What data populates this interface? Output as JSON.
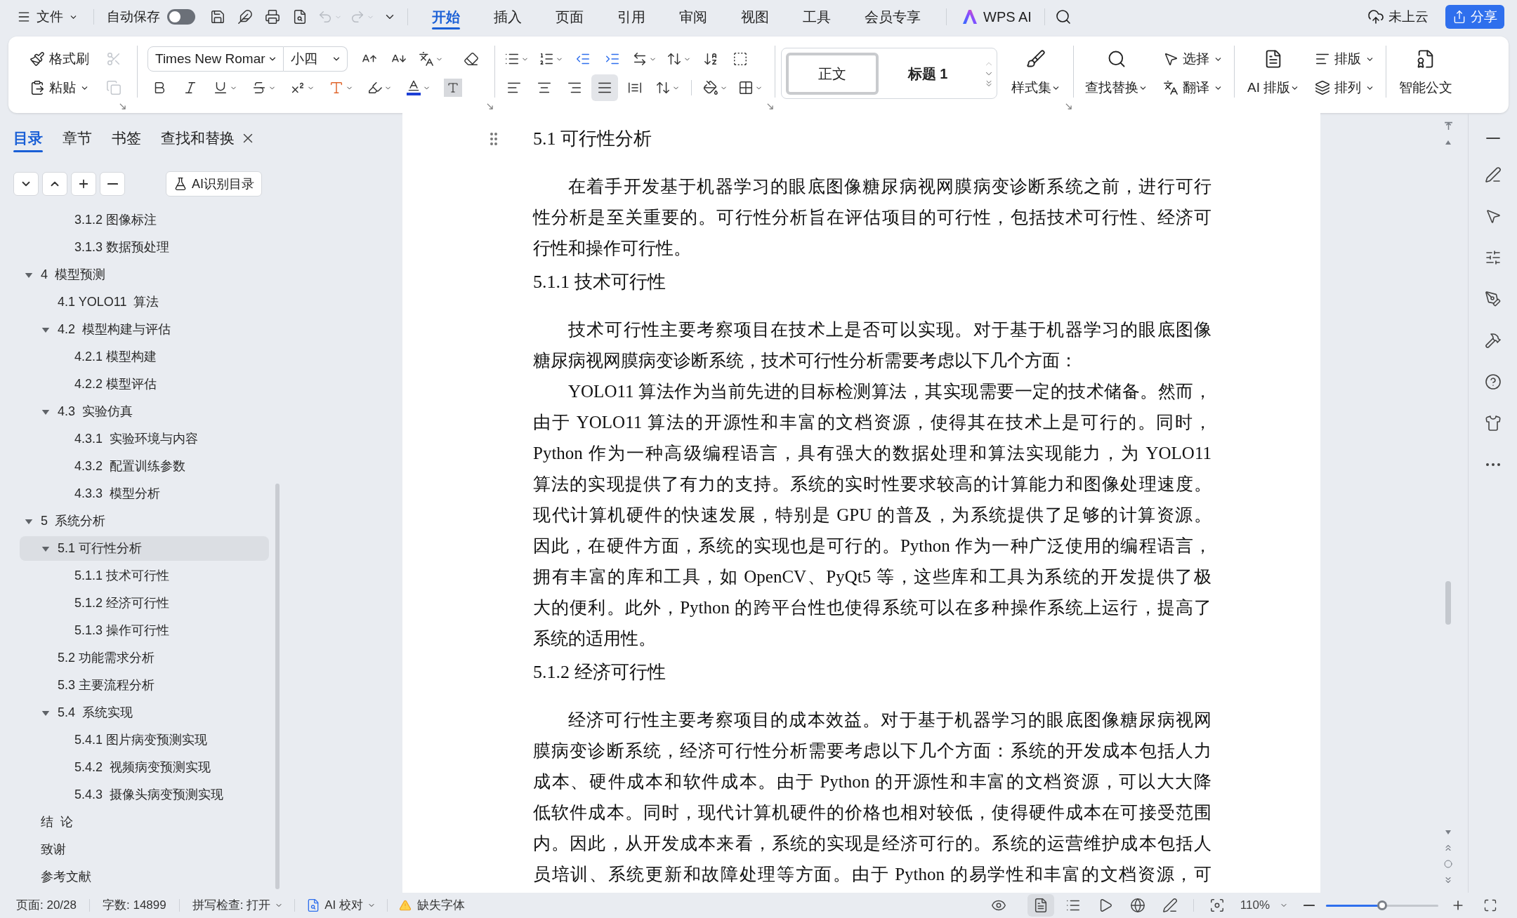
{
  "menu_bar": {
    "file_menu": "文件",
    "autosave": {
      "label": "自动保存",
      "on": false
    },
    "undo": {
      "disabled": true
    },
    "redo": {
      "disabled": true
    },
    "tabs": [
      {
        "label": "开始",
        "selected": true
      },
      {
        "label": "插入",
        "selected": false
      },
      {
        "label": "页面",
        "selected": false
      },
      {
        "label": "引用",
        "selected": false
      },
      {
        "label": "审阅",
        "selected": false
      },
      {
        "label": "视图",
        "selected": false
      },
      {
        "label": "工具",
        "selected": false
      },
      {
        "label": "会员专享",
        "selected": false
      }
    ],
    "ai_button": "WPS AI",
    "cloud_status": "未上云",
    "share_button": "分享"
  },
  "ribbon": {
    "clipboard": {
      "format_painter": "格式刷",
      "paste": "粘贴",
      "cut": {
        "disabled": true
      },
      "copy": {
        "disabled": true
      }
    },
    "font": {
      "name": "Times New Romar",
      "size": "小四"
    },
    "alignment": [
      {
        "selected": false
      },
      {
        "selected": false
      },
      {
        "selected": false
      },
      {
        "selected": true
      },
      {
        "selected": false
      }
    ],
    "styles": [
      {
        "kind": "body",
        "label": "正文",
        "selected": true
      },
      {
        "kind": "heading",
        "label": "标题 1",
        "selected": false
      }
    ],
    "style_set": "样式集",
    "find_replace": "查找替换",
    "select": "选择",
    "translate": "翻译",
    "ai_layout": "AI 排版",
    "layout": "排版",
    "arrange": "排列",
    "smart_document": "智能公文"
  },
  "navigation": {
    "tabs": [
      {
        "label": "目录",
        "selected": true
      },
      {
        "label": "章节",
        "selected": false
      },
      {
        "label": "书签",
        "selected": false
      },
      {
        "label": "查找和替换",
        "selected": false
      }
    ],
    "ai_toc_button": "AI识别目录",
    "toc": {
      "continued_items": [
        {
          "label": "3.1.2 图像标注",
          "selected": false
        },
        {
          "label": "3.1.3 数据预处理",
          "selected": false
        }
      ],
      "items": [
        {
          "label": "4  模型预测",
          "selected": false,
          "expanded": true,
          "children": [
            {
              "label": "4.1 YOLO11  算法",
              "selected": false
            },
            {
              "label": "4.2  模型构建与评估",
              "selected": false,
              "expanded": true,
              "children": [
                {
                  "label": "4.2.1 模型构建",
                  "selected": false
                },
                {
                  "label": "4.2.2 模型评估",
                  "selected": false
                }
              ]
            },
            {
              "label": "4.3  实验仿真",
              "selected": false,
              "expanded": true,
              "children": [
                {
                  "label": "4.3.1  实验环境与内容",
                  "selected": false
                },
                {
                  "label": "4.3.2  配置训练参数",
                  "selected": false
                },
                {
                  "label": "4.3.3  模型分析",
                  "selected": false
                }
              ]
            }
          ]
        },
        {
          "label": "5  系统分析",
          "selected": false,
          "expanded": true,
          "children": [
            {
              "label": "5.1 可行性分析",
              "selected": true,
              "expanded": true,
              "children": [
                {
                  "label": "5.1.1 技术可行性",
                  "selected": false
                },
                {
                  "label": "5.1.2 经济可行性",
                  "selected": false
                },
                {
                  "label": "5.1.3 操作可行性",
                  "selected": false
                }
              ]
            },
            {
              "label": "5.2 功能需求分析",
              "selected": false
            },
            {
              "label": "5.3 主要流程分析",
              "selected": false
            },
            {
              "label": "5.4  系统实现",
              "selected": false,
              "expanded": true,
              "children": [
                {
                  "label": "5.4.1 图片病变预测实现",
                  "selected": false
                },
                {
                  "label": "5.4.2  视频病变预测实现",
                  "selected": false
                },
                {
                  "label": "5.4.3  摄像头病变预测实现",
                  "selected": false
                }
              ]
            }
          ]
        },
        {
          "label": "结  论",
          "selected": false
        },
        {
          "label": "致谢",
          "selected": false
        },
        {
          "label": "参考文献",
          "selected": false
        }
      ]
    }
  },
  "document": {
    "blocks": [
      {
        "kind": "heading",
        "text": "5.1 可行性分析"
      },
      {
        "kind": "paragraph",
        "lines": [
          "在着手开发基于机器学习的眼底图像糖尿病视网膜病变诊断系统之前，进行可行",
          "性分析是至关重要的。可行性分析旨在评估项目的可行性，包括技术可行性、经济可",
          "行性和操作可行性。"
        ]
      },
      {
        "kind": "heading",
        "text": "5.1.1 技术可行性"
      },
      {
        "kind": "paragraph",
        "lines": [
          "技术可行性主要考察项目在技术上是否可以实现。对于基于机器学习的眼底图像",
          "糖尿病视网膜病变诊断系统，技术可行性分析需要考虑以下几个方面："
        ]
      },
      {
        "kind": "paragraph",
        "lines": [
          "YOLO11 算法作为当前先进的目标检测算法，其实现需要一定的技术储备。然而，",
          "由于 YOLO11 算法的开源性和丰富的文档资源，使得其在技术上是可行的。同时，",
          "Python 作为一种高级编程语言，具有强大的数据处理和算法实现能力，为 YOLO11",
          "算法的实现提供了有力的支持。系统的实时性要求较高的计算能力和图像处理速度。",
          "现代计算机硬件的快速发展，特别是 GPU 的普及，为系统提供了足够的计算资源。",
          "因此，在硬件方面，系统的实现也是可行的。Python 作为一种广泛使用的编程语言，",
          "拥有丰富的库和工具，如 OpenCV、PyQt5 等，这些库和工具为系统的开发提供了极",
          "大的便利。此外，Python 的跨平台性也使得系统可以在多种操作系统上运行，提高了",
          "系统的适用性。"
        ]
      },
      {
        "kind": "heading",
        "text": "5.1.2 经济可行性"
      },
      {
        "kind": "paragraph",
        "continues": true,
        "lines": [
          "经济可行性主要考察项目的成本效益。对于基于机器学习的眼底图像糖尿病视网",
          "膜病变诊断系统，经济可行性分析需要考虑以下几个方面：系统的开发成本包括人力",
          "成本、硬件成本和软件成本。由于 Python 的开源性和丰富的文档资源，可以大大降",
          "低软件成本。同时，现代计算机硬件的价格也相对较低，使得硬件成本在可接受范围",
          "内。因此，从开发成本来看，系统的实现是经济可行的。系统的运营维护成本包括人",
          "员培训、系统更新和故障处理等方面。由于 Python 的易学性和丰富的文档资源，可"
        ]
      }
    ]
  },
  "status_bar": {
    "page": "页面: 20/28",
    "word_count": "字数: 14899",
    "spell_check": "拼写检查: 打开",
    "ai_proofread": "AI 校对",
    "missing_fonts": "缺失字体",
    "view_modes": [
      {
        "selected": true
      },
      {
        "selected": false
      },
      {
        "selected": false
      },
      {
        "selected": false
      },
      {
        "selected": false
      }
    ],
    "zoom": {
      "reading": "110%",
      "level": 0.5
    }
  }
}
